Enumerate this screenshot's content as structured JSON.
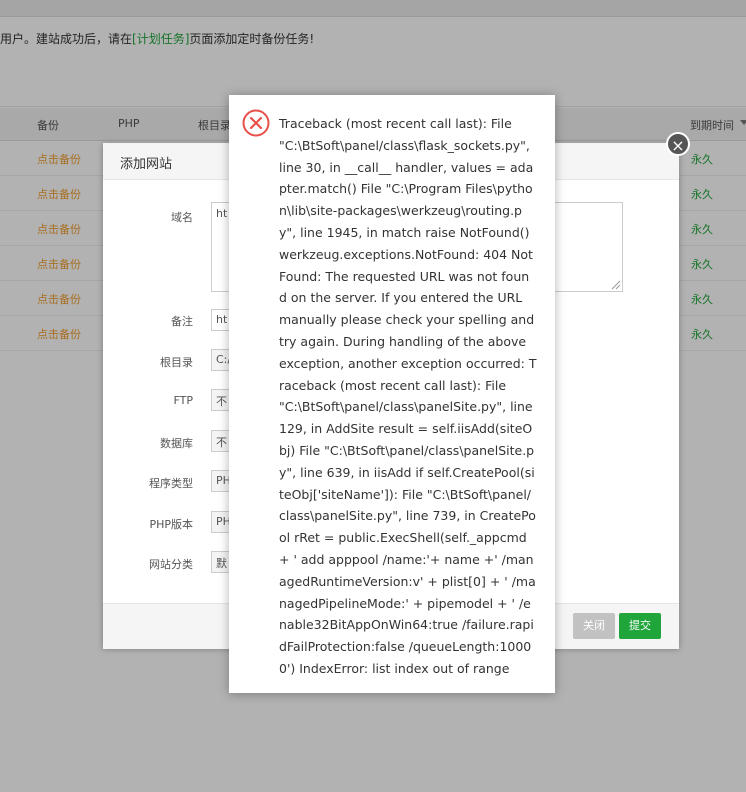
{
  "notice": {
    "text_before": "用户。建站成功后，请在",
    "link": "[计划任务]",
    "text_after": "页面添加定时备份任务!"
  },
  "table": {
    "headers": [
      "备份",
      "PHP",
      "根目录",
      "到期时间"
    ],
    "rows": [
      {
        "backup": "点击备份",
        "expire": "永久"
      },
      {
        "backup": "点击备份",
        "expire": "永久"
      },
      {
        "backup": "点击备份",
        "expire": "永久"
      },
      {
        "backup": "点击备份",
        "expire": "永久"
      },
      {
        "backup": "点击备份",
        "expire": "永久"
      },
      {
        "backup": "点击备份",
        "expire": "永久"
      }
    ]
  },
  "dialog": {
    "title": "添加网站",
    "fields": {
      "domain_label": "域名",
      "domain_value": "ht",
      "remark_label": "备注",
      "remark_value": "ht",
      "root_label": "根目录",
      "root_value": "C:/",
      "ftp_label": "FTP",
      "ftp_value": "不",
      "db_label": "数据库",
      "db_value": "不",
      "program_label": "程序类型",
      "program_value": "PH",
      "php_label": "PHP版本",
      "php_value": "PH",
      "category_label": "网站分类",
      "category_value": "默"
    },
    "close_button": "关闭",
    "submit_button": "提交"
  },
  "error": {
    "icon": "error-x-icon",
    "message": "Traceback (most recent call last): File \"C:\\BtSoft\\panel/class\\flask_sockets.py\", line 30, in __call__ handler, values = adapter.match() File \"C:\\Program Files\\python\\lib\\site-packages\\werkzeug\\routing.py\", line 1945, in match raise NotFound() werkzeug.exceptions.NotFound: 404 Not Found: The requested URL was not found on the server. If you entered the URL manually please check your spelling and try again. During handling of the above exception, another exception occurred: Traceback (most recent call last): File \"C:\\BtSoft\\panel/class\\panelSite.py\", line 129, in AddSite result = self.iisAdd(siteObj) File \"C:\\BtSoft\\panel/class\\panelSite.py\", line 639, in iisAdd if self.CreatePool(siteObj['siteName']): File \"C:\\BtSoft\\panel/class\\panelSite.py\", line 739, in CreatePool rRet = public.ExecShell(self._appcmd + ' add apppool /name:'+ name +' /managedRuntimeVersion:v' + plist[0] + ' /managedPipelineMode:' + pipemodel + ' /enable32BitAppOnWin64:true /failure.rapidFailProtection:false /queueLength:10000') IndexError: list index out of range"
  },
  "colors": {
    "accent": "#20a53a",
    "warning": "#f0a030",
    "error": "#e8504a"
  }
}
